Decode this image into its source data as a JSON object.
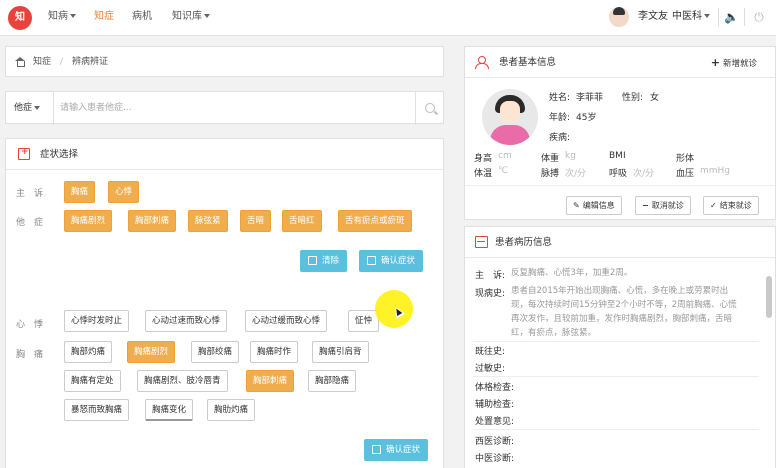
{
  "topbar": {
    "logo_text": "知",
    "nav": [
      {
        "label": "知病",
        "dropdown": true
      },
      {
        "label": "知症",
        "active": true
      },
      {
        "label": "病机"
      },
      {
        "label": "知识库",
        "dropdown": true
      }
    ],
    "user_name": "李文友",
    "department": "中医科"
  },
  "breadcrumb": {
    "root": "知症",
    "separator": "/",
    "current": "辨病辨证"
  },
  "other_symptom": {
    "label": "他症",
    "placeholder": "请输入患者他症..."
  },
  "symptom_panel": {
    "title": "症状选择",
    "chief_label": "主　诉",
    "chief": [
      "胸痛",
      "心悸"
    ],
    "other_label": "他　症",
    "other": [
      "胸痛剧烈",
      "胸部刺痛",
      "脉弦紧",
      "舌暗",
      "舌暗红",
      "舌有瘀点或瘀斑"
    ],
    "clear_label": "清除",
    "confirm_label": "确认症状",
    "palpitation_label": "心　悸",
    "palpitation": [
      "心悸时发时止",
      "心动过速而致心悸",
      "心动过缓而致心悸",
      "怔忡"
    ],
    "chest_label": "胸　痛",
    "chest_rows": [
      [
        "胸部灼痛",
        "胸痛剧烈",
        "胸部绞痛",
        "胸痛时作",
        "胸痛引肩背"
      ],
      [
        "胸痛有定处",
        "胸痛剧烈、肢冷唇青",
        "胸部刺痛",
        "胸部隐痛"
      ],
      [
        "暴怒而致胸痛",
        "胸痛变化",
        "胸肋灼痛"
      ]
    ],
    "chest_selected": [
      "胸痛剧烈",
      "胸部刺痛"
    ],
    "confirm_label_2": "确认症状"
  },
  "patient": {
    "title": "患者基本信息",
    "new_visit": "新增就诊",
    "name_label": "姓名:",
    "name": "李菲菲",
    "gender_label": "性别:",
    "gender": "女",
    "age_label": "年龄:",
    "age": "45岁",
    "disease_label": "疾病:",
    "vitals": [
      {
        "label": "身高",
        "unit": "cm"
      },
      {
        "label": "体重",
        "unit": "kg"
      },
      {
        "label": "BMI",
        "unit": ""
      },
      {
        "label": "形体",
        "unit": ""
      },
      {
        "label": "体温",
        "unit": "℃"
      },
      {
        "label": "脉搏",
        "unit": "次/分"
      },
      {
        "label": "呼吸",
        "unit": "次/分"
      },
      {
        "label": "血压",
        "unit": "mmHg"
      }
    ],
    "edit_label": "编辑信息",
    "cancel_label": "取消就诊",
    "end_label": "结束就诊"
  },
  "history": {
    "title": "患者病历信息",
    "chief_label": "主　诉:",
    "chief": "反复胸痛、心慌3年，加重2周。",
    "present_label": "现病史:",
    "present_lines": [
      "患者自2015年开始出现胸痛、心慌，多在晚上或劳累时出",
      "现，每次持续时间15分钟至2个小时不等，2周前胸痛、心慌",
      "再次发作，且较前加重，发作时胸痛剧烈，胸部刺痛，舌暗",
      "红，有瘀点，脉弦紧。"
    ],
    "past_label": "既往史:",
    "allergy_label": "过敏史:",
    "exam_label": "体格检查:",
    "aux_label": "辅助检查:",
    "treat_label": "处置意见:",
    "west_label": "西医诊断:",
    "tcm_label": "中医诊断:"
  }
}
